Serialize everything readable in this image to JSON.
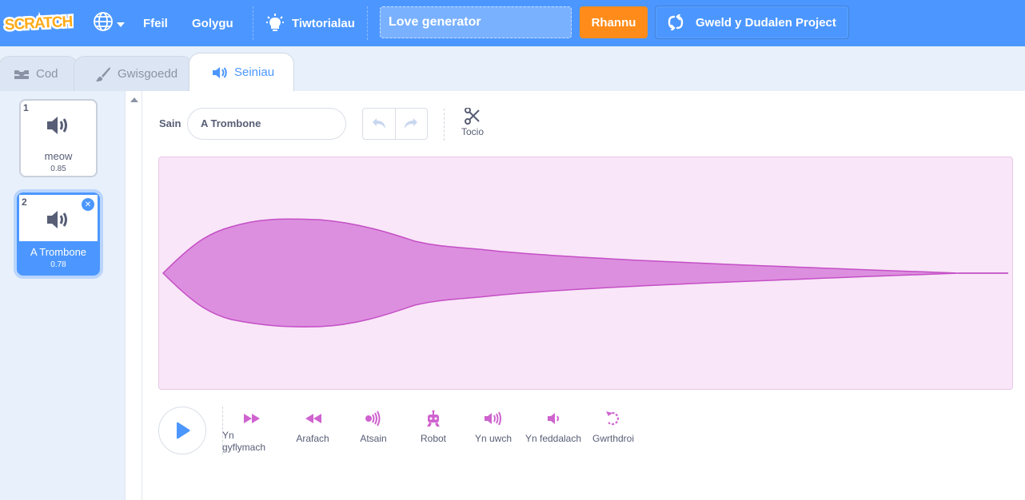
{
  "menubar": {
    "logo_text": "SCRATCH",
    "file": "Ffeil",
    "edit": "Golygu",
    "tutorials": "Tiwtorialau",
    "project_title": "Love generator",
    "share": "Rhannu",
    "see_project_page": "Gweld y Dudalen Project"
  },
  "tabs": {
    "code": "Cod",
    "costumes": "Gwisgoedd",
    "sounds": "Seiniau"
  },
  "sounds": [
    {
      "number": "1",
      "name": "meow",
      "duration": "0.85"
    },
    {
      "number": "2",
      "name": "A Trombone",
      "duration": "0.78"
    }
  ],
  "editor": {
    "sound_label": "Sain",
    "sound_name": "A Trombone",
    "trim_label": "Tocio"
  },
  "effects": [
    {
      "label": "Yn gyflymach",
      "icon": "faster-icon"
    },
    {
      "label": "Arafach",
      "icon": "slower-icon"
    },
    {
      "label": "Atsain",
      "icon": "echo-icon"
    },
    {
      "label": "Robot",
      "icon": "robot-icon"
    },
    {
      "label": "Yn uwch",
      "icon": "louder-icon"
    },
    {
      "label": "Yn feddalach",
      "icon": "softer-icon"
    },
    {
      "label": "Gwrthdroi",
      "icon": "reverse-icon"
    }
  ],
  "colors": {
    "menubar": "#4c97ff",
    "share": "#ff8c1a",
    "waveform_fill": "#dd8fdf",
    "waveform_bg": "#f9e6f8",
    "effect_icon": "#cf63cf"
  }
}
